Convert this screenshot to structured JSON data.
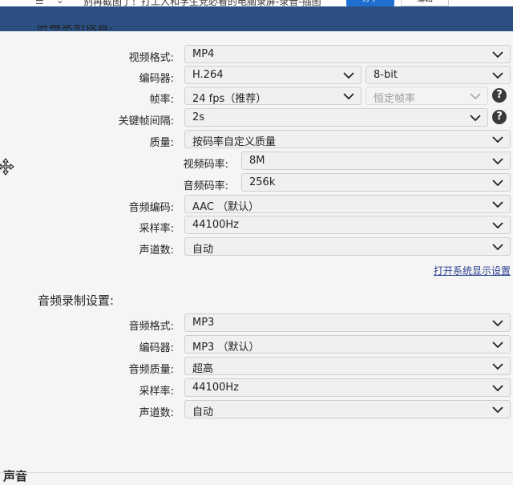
{
  "background_strip": {
    "title_text": "别再截图了！打工人和学生党必看的电脑录屏-录音-插图",
    "share_label": "分享",
    "edit_label": "编辑"
  },
  "colors": {
    "titlebar": "#2b4f81",
    "link": "#2b3f8f",
    "panel_bg": "#f5f5f5"
  },
  "screen_record": {
    "title": "屏幕录制设置:",
    "video_format": {
      "label": "视频格式:",
      "value": "MP4"
    },
    "encoder": {
      "label": "编码器:",
      "value": "H.264",
      "bitdepth": "8-bit"
    },
    "framerate": {
      "label": "帧率:",
      "value": "24 fps（推荐）",
      "mode": "恒定帧率"
    },
    "keyframe": {
      "label": "关键帧间隔:",
      "value": "2s"
    },
    "quality": {
      "label": "质量:",
      "value": "按码率自定义质量"
    },
    "video_bitrate": {
      "label": "视频码率:",
      "value": "8M"
    },
    "audio_bitrate": {
      "label": "音频码率:",
      "value": "256k"
    },
    "audio_codec": {
      "label": "音频编码:",
      "value": "AAC （默认）"
    },
    "samplerate": {
      "label": "采样率:",
      "value": "44100Hz"
    },
    "channels": {
      "label": "声道数:",
      "value": "自动"
    },
    "display_settings_link": "打开系统显示设置"
  },
  "audio_record": {
    "title": "音频录制设置:",
    "audio_format": {
      "label": "音频格式:",
      "value": "MP3"
    },
    "encoder": {
      "label": "编码器:",
      "value": "MP3 （默认）"
    },
    "quality": {
      "label": "音频质量:",
      "value": "超高"
    },
    "samplerate": {
      "label": "采样率:",
      "value": "44100Hz"
    },
    "channels": {
      "label": "声道数:",
      "value": "自动"
    }
  },
  "bottom_section": {
    "title": "声音"
  },
  "icons": {
    "dropdown": "chevron-down-icon",
    "help": "question-mark-icon",
    "cursor": "move-cursor-icon"
  }
}
